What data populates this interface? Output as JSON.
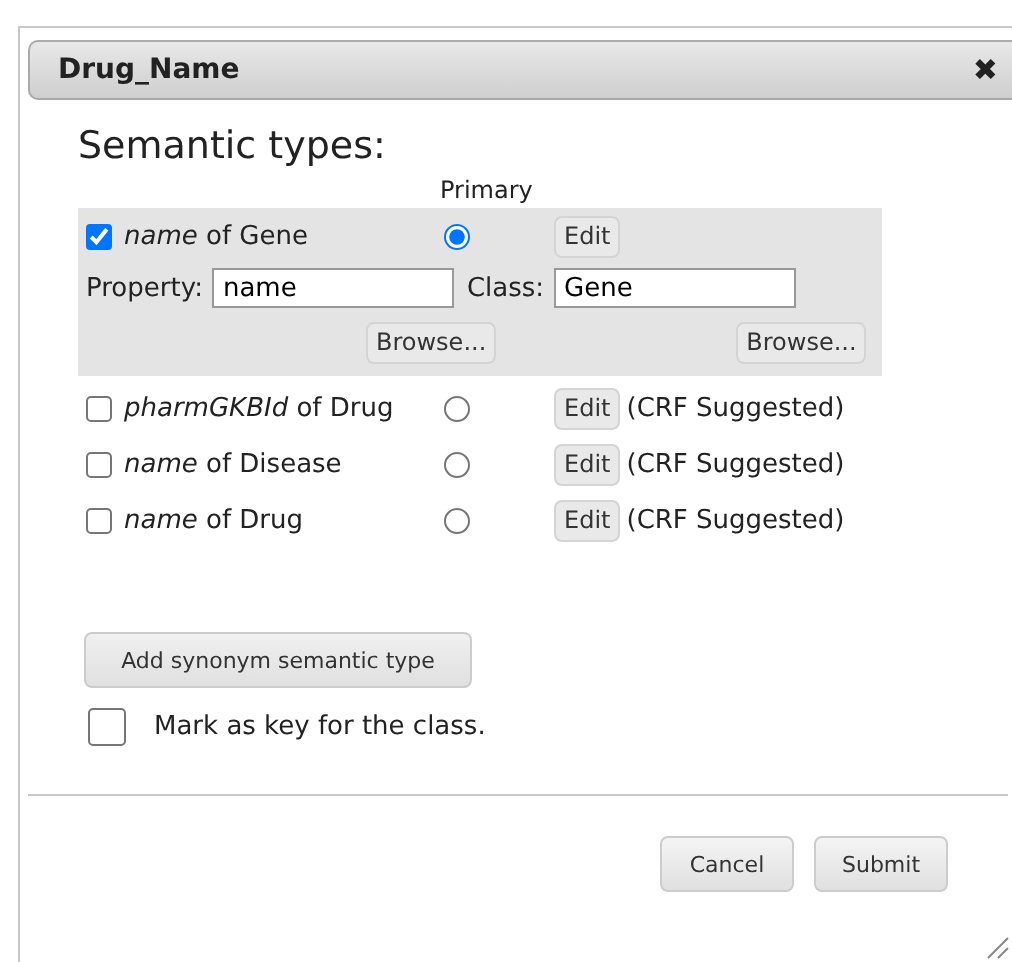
{
  "dialog": {
    "title": "Drug_Name",
    "close": "✖"
  },
  "heading": "Semantic types:",
  "primary_label": "Primary",
  "semantic_types": [
    {
      "label": "*name* of Gene",
      "checked": true,
      "selected": true,
      "edit": "Edit",
      "expanded": true,
      "property_label": "Property:",
      "property_value": "name",
      "class_label": "Class:",
      "class_value": "Gene",
      "browse": [
        "Browse...",
        "Browse..."
      ]
    },
    {
      "label": "*pharmGKBId* of Drug",
      "checked": false,
      "selected": false,
      "edit": "Edit",
      "expanded": false,
      "note": "(CRF Suggested)"
    },
    {
      "label": "*name* of Disease",
      "checked": false,
      "selected": false,
      "edit": "Edit",
      "expanded": false,
      "note": "(CRF Suggested)"
    },
    {
      "label": "*name* of Drug",
      "checked": false,
      "selected": false,
      "edit": "Edit",
      "expanded": false,
      "note": "(CRF Suggested)"
    }
  ],
  "add_button": "Add synonym semantic type",
  "key_option": {
    "label": "Mark as key for the class.",
    "checked": false
  },
  "buttons": [
    "Cancel",
    "Submit"
  ]
}
